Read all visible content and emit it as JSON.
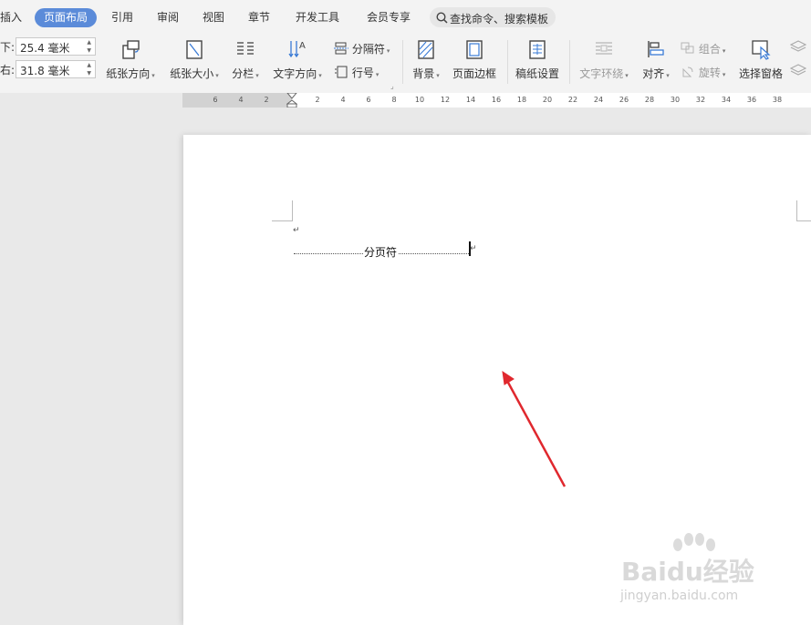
{
  "tabs": [
    {
      "label": "插入",
      "active": false
    },
    {
      "label": "页面布局",
      "active": true
    },
    {
      "label": "引用",
      "active": false
    },
    {
      "label": "审阅",
      "active": false
    },
    {
      "label": "视图",
      "active": false
    },
    {
      "label": "章节",
      "active": false
    },
    {
      "label": "开发工具",
      "active": false
    },
    {
      "label": "会员专享",
      "active": false
    }
  ],
  "search": {
    "label": "查找命令、搜索模板"
  },
  "margins": {
    "bottom_label": "下:",
    "bottom_value": "25.4 毫米",
    "right_label": "右:",
    "right_value": "31.8 毫米"
  },
  "toolbar": {
    "orientation": "纸张方向",
    "size": "纸张大小",
    "columns": "分栏",
    "text_direction": "文字方向",
    "separator": "分隔符",
    "line_number": "行号",
    "background": "背景",
    "page_border": "页面边框",
    "manuscript": "稿纸设置",
    "text_wrap": "文字环绕",
    "align": "对齐",
    "group": "组合",
    "rotate": "旋转",
    "selection_pane": "选择窗格"
  },
  "ruler": {
    "ticks": [
      "6",
      "4",
      "2",
      "2",
      "4",
      "6",
      "8",
      "10",
      "12",
      "14",
      "16",
      "18",
      "20",
      "22",
      "24",
      "26",
      "28",
      "30",
      "32",
      "34",
      "36",
      "38"
    ]
  },
  "document": {
    "page_break_label": "分页符",
    "paragraph_mark": "↵"
  },
  "watermark": {
    "brand": "Baidu经验",
    "url": "jingyan.baidu.com"
  },
  "colors": {
    "accent": "#5b8bd9",
    "arrow": "#e0282e"
  }
}
